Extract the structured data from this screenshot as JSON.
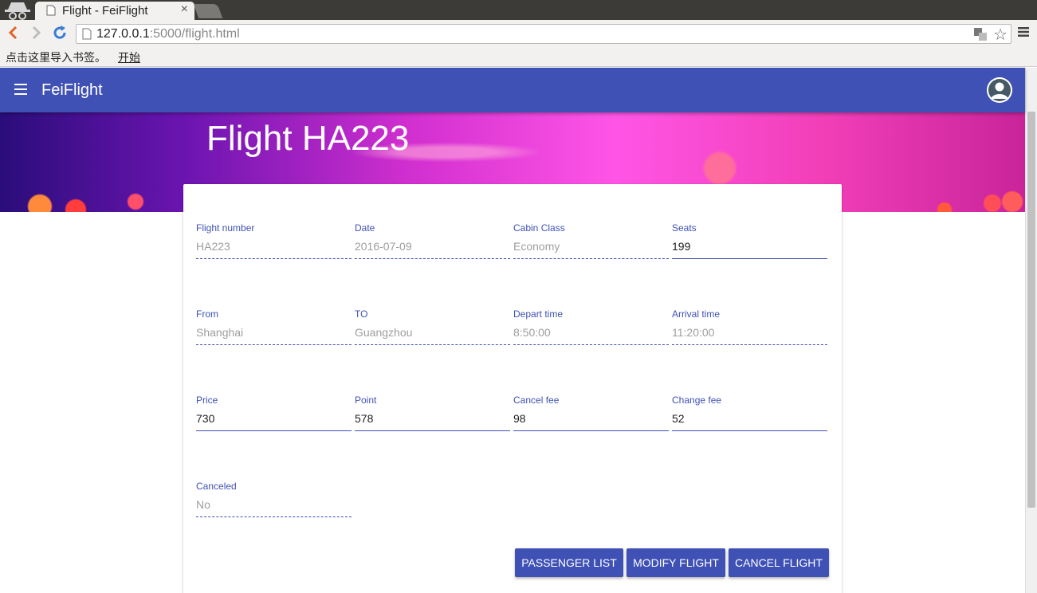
{
  "browser": {
    "tab_title": "Flight - FeiFlight",
    "tab_close": "×",
    "url_host": "127.0.0.1",
    "url_rest": ":5000/flight.html",
    "star": "☆",
    "bookmarks_text": "点击这里导入书签。",
    "bookmarks_link": "开始"
  },
  "app": {
    "title": "FeiFlight"
  },
  "hero": {
    "title": "Flight HA223"
  },
  "fields": {
    "flight_number": {
      "label": "Flight number",
      "value": "HA223"
    },
    "date": {
      "label": "Date",
      "value": "2016-07-09"
    },
    "cabin_class": {
      "label": "Cabin Class",
      "value": "Economy"
    },
    "seats": {
      "label": "Seats",
      "value": "199"
    },
    "from": {
      "label": "From",
      "value": "Shanghai"
    },
    "to": {
      "label": "TO",
      "value": "Guangzhou"
    },
    "depart_time": {
      "label": "Depart time",
      "value": "8:50:00"
    },
    "arrival_time": {
      "label": "Arrival time",
      "value": "11:20:00"
    },
    "price": {
      "label": "Price",
      "value": "730"
    },
    "point": {
      "label": "Point",
      "value": "578"
    },
    "cancel_fee": {
      "label": "Cancel fee",
      "value": "98"
    },
    "change_fee": {
      "label": "Change fee",
      "value": "52"
    },
    "canceled": {
      "label": "Canceled",
      "value": "No"
    }
  },
  "buttons": {
    "passenger_list": "PASSENGER LIST",
    "modify_flight": "MODIFY FLIGHT",
    "cancel_flight": "CANCEL FLIGHT"
  },
  "colors": {
    "primary": "#3f51b5",
    "disabled_text": "#9e9e9e"
  }
}
